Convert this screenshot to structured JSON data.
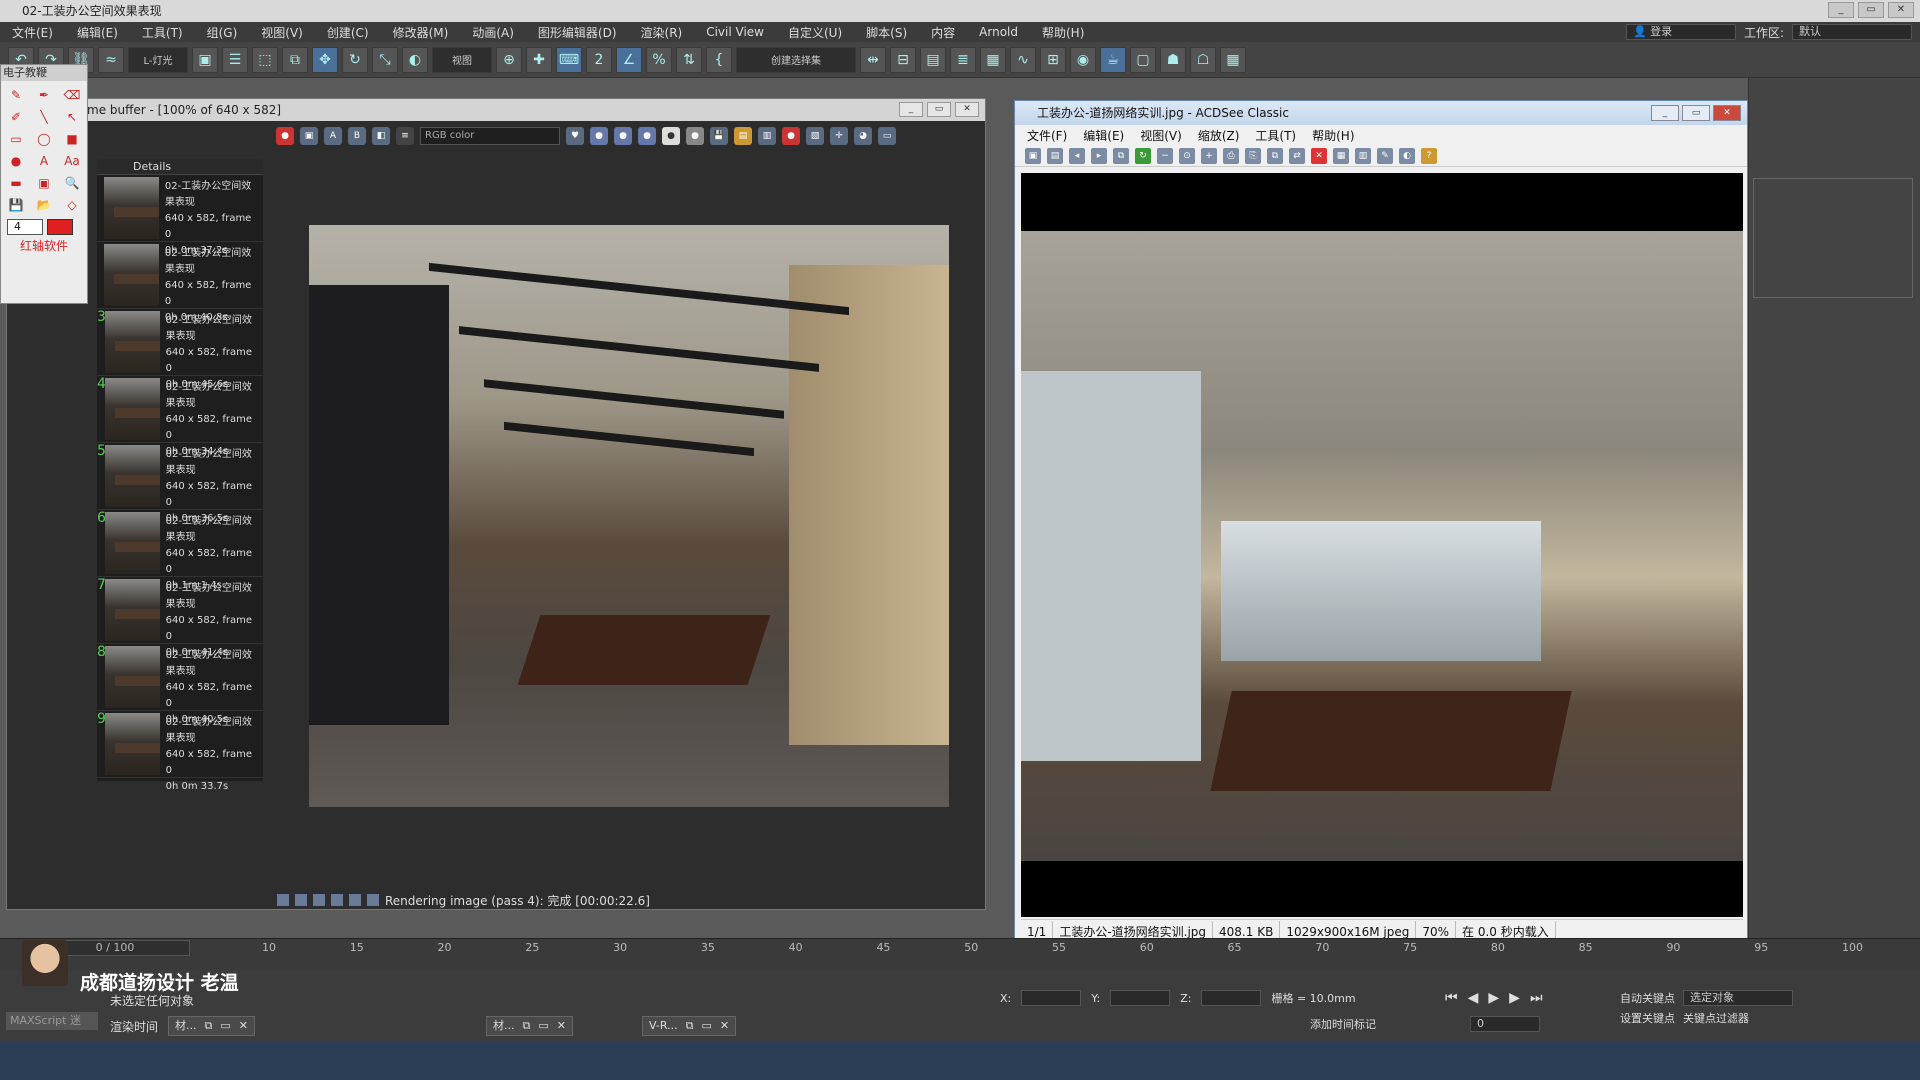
{
  "app": {
    "title": "02-工装办公空间效果表现",
    "menu": [
      "文件(E)",
      "编辑(E)",
      "工具(T)",
      "组(G)",
      "视图(V)",
      "创建(C)",
      "修改器(M)",
      "动画(A)",
      "图形编辑器(D)",
      "渲染(R)",
      "Civil View",
      "自定义(U)",
      "脚本(S)",
      "内容",
      "Arnold",
      "帮助(H)"
    ],
    "login": "登录",
    "workspace_label": "工作区:",
    "workspace_value": "默认"
  },
  "toolbar": {
    "filter": "L-灯光",
    "view_mode": "视图",
    "selection_set": "创建选择集"
  },
  "palette": {
    "title": "电子教鞭",
    "size_value": "4",
    "brand": "红轴软件"
  },
  "frame_buffer": {
    "title": "me buffer - [100% of 640 x 582]",
    "channel": "RGB color",
    "history_header": "Details",
    "history": [
      {
        "num": "",
        "name": "02-工装办公空间效果表现",
        "res": "640 x 582, frame 0",
        "time": "0h 0m 37.2s"
      },
      {
        "num": "",
        "name": "02-工装办公空间效果表现",
        "res": "640 x 582, frame 0",
        "time": "0h 0m 40.8s"
      },
      {
        "num": "3",
        "name": "02-工装办公空间效果表现",
        "res": "640 x 582, frame 0",
        "time": "0h 0m 45.6s"
      },
      {
        "num": "4",
        "name": "02-工装办公空间效果表现",
        "res": "640 x 582, frame 0",
        "time": "0h 0m 34.4s"
      },
      {
        "num": "5",
        "name": "02-工装办公空间效果表现",
        "res": "640 x 582, frame 0",
        "time": "0h 0m 36.5s"
      },
      {
        "num": "6",
        "name": "02-工装办公空间效果表现",
        "res": "640 x 582, frame 0",
        "time": "0h 1m 1.4s"
      },
      {
        "num": "7",
        "name": "02-工装办公空间效果表现",
        "res": "640 x 582, frame 0",
        "time": "0h 0m 41.4s"
      },
      {
        "num": "8",
        "name": "02-工装办公空间效果表现",
        "res": "640 x 582, frame 0",
        "time": "0h 0m 40.5s"
      },
      {
        "num": "9",
        "name": "02-工装办公空间效果表现",
        "res": "640 x 582, frame 0",
        "time": "0h 0m 33.7s"
      }
    ],
    "status": "Rendering image (pass 4): 完成 [00:00:22.6]"
  },
  "acdsee": {
    "title": "工装办公-道扬网络实训.jpg - ACDSee Classic",
    "menu": [
      "文件(F)",
      "编辑(E)",
      "视图(V)",
      "缩放(Z)",
      "工具(T)",
      "帮助(H)"
    ],
    "status": {
      "page": "1/1",
      "filename": "工装办公-道扬网络实训.jpg",
      "size": "408.1 KB",
      "dims": "1029x900x16M jpeg",
      "zoom": "70%",
      "load": "在 0.0 秒内载入"
    }
  },
  "timeline": {
    "frame_counter": "0 / 100",
    "ticks": [
      "10",
      "15",
      "20",
      "25",
      "30",
      "35",
      "40",
      "45",
      "50",
      "55",
      "60",
      "65",
      "70",
      "75",
      "80",
      "85",
      "90",
      "95",
      "100"
    ]
  },
  "bottom": {
    "streamer": "成都道扬设计  老温",
    "selection_status": "未选定任何对象",
    "maxscript": "MAXScript 迷",
    "render_time_label": "渲染时间",
    "tasks": [
      "材...",
      "材...",
      "V-R..."
    ],
    "x_label": "X:",
    "y_label": "Y:",
    "z_label": "Z:",
    "grid": "栅格 = 10.0mm",
    "add_time_tag": "添加时间标记",
    "auto_key": "自动关键点",
    "set_key": "设置关键点",
    "key_target": "选定对象",
    "key_filter": "关键点过滤器",
    "frame_value": "0"
  }
}
